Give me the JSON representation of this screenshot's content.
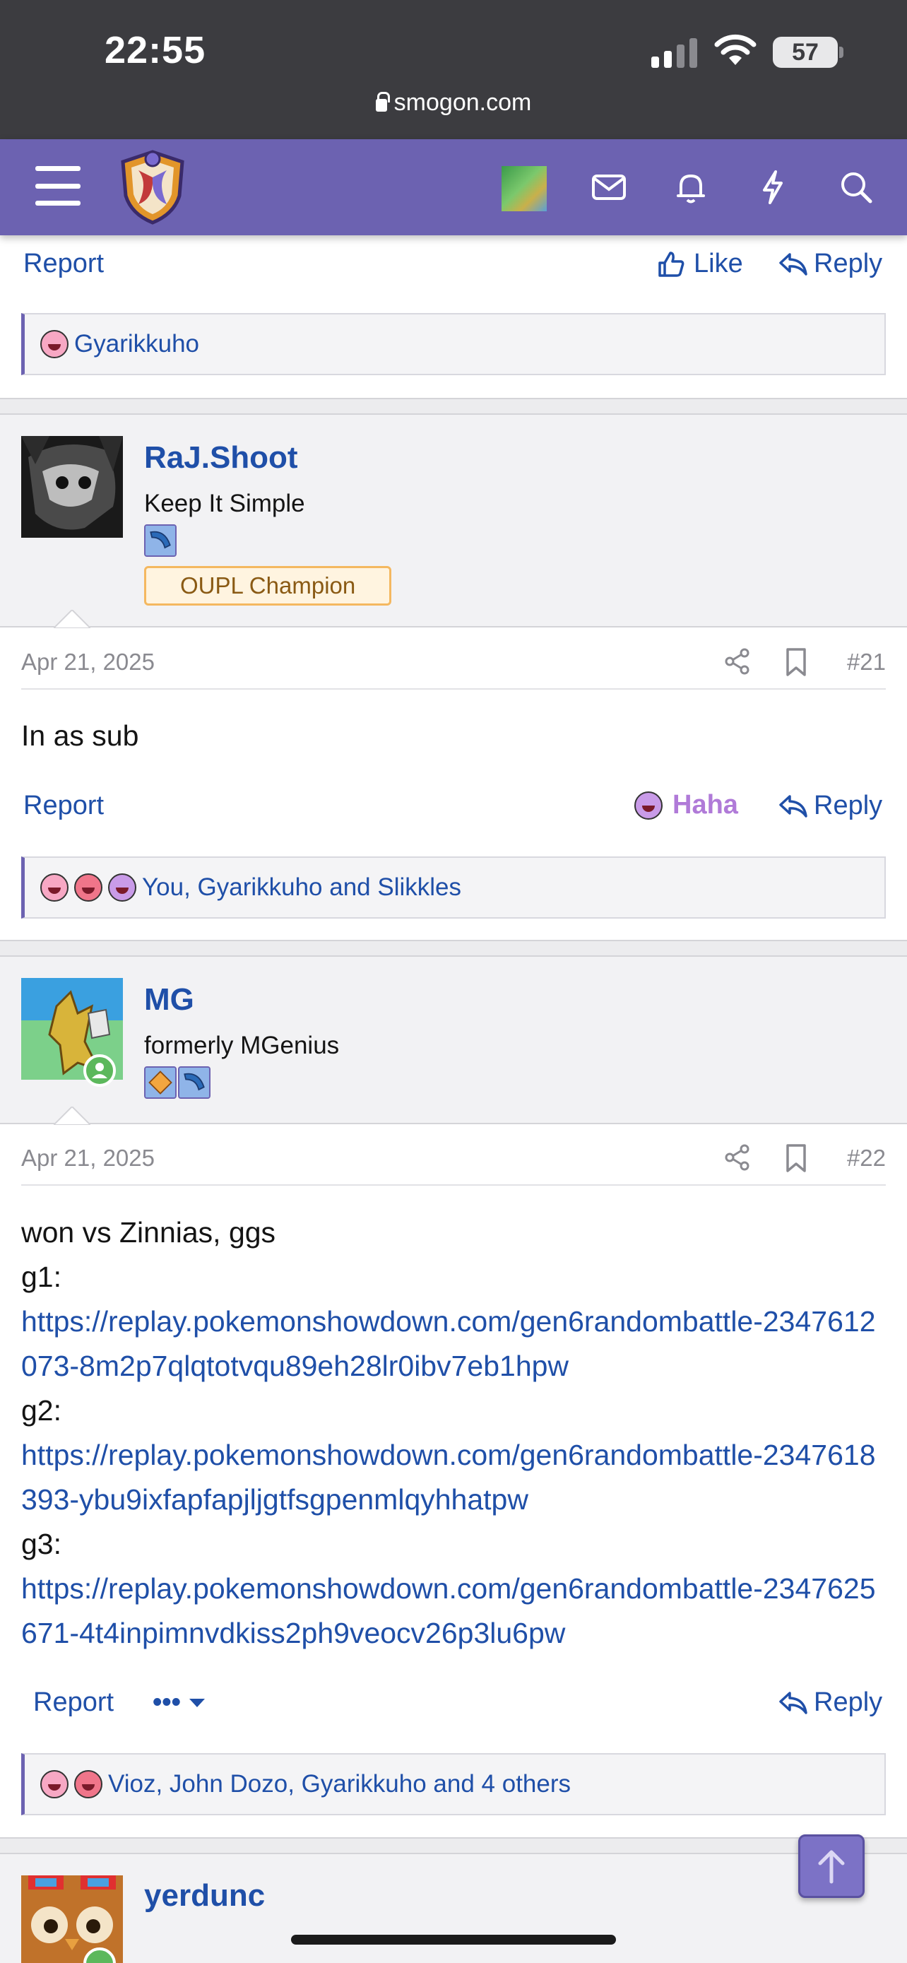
{
  "status": {
    "time": "22:55",
    "battery": "57",
    "url": "smogon.com"
  },
  "prev_post": {
    "report": "Report",
    "like": "Like",
    "reply": "Reply",
    "reactions": "Gyarikkuho"
  },
  "post21": {
    "username": "RaJ.Shoot",
    "title": "Keep It Simple",
    "banner": "OUPL Champion",
    "date": "Apr 21, 2025",
    "number": "#21",
    "body": "In as sub",
    "report": "Report",
    "haha": "Haha",
    "reply": "Reply",
    "reactions": "You, Gyarikkuho and Slikkles"
  },
  "post22": {
    "username": "MG",
    "title": "formerly MGenius",
    "date": "Apr 21, 2025",
    "number": "#22",
    "lines": {
      "intro": "won vs Zinnias, ggs",
      "g1": "g1:",
      "g1_link": "https://replay.pokemonshowdown.com/gen6randombattle-2347612073-8m2p7qlqtotvqu89eh28lr0ibv7eb1hpw",
      "g2": "g2:",
      "g2_link": "https://replay.pokemonshowdown.com/gen6randombattle-2347618393-ybu9ixfapfapjljgtfsgpenmlqyhhatpw",
      "g3": "g3:",
      "g3_link": "https://replay.pokemonshowdown.com/gen6randombattle-2347625671-4t4inpimnvdkiss2ph9veocv26p3lu6pw"
    },
    "report": "Report",
    "more": "•••",
    "reply": "Reply",
    "reactions": "Vioz, John Dozo, Gyarikkuho and 4 others"
  },
  "post23": {
    "username": "yerdunc"
  },
  "colors": {
    "nav": "#6c62b1",
    "link": "#1f4fa8",
    "haha": "#b07ad8"
  }
}
